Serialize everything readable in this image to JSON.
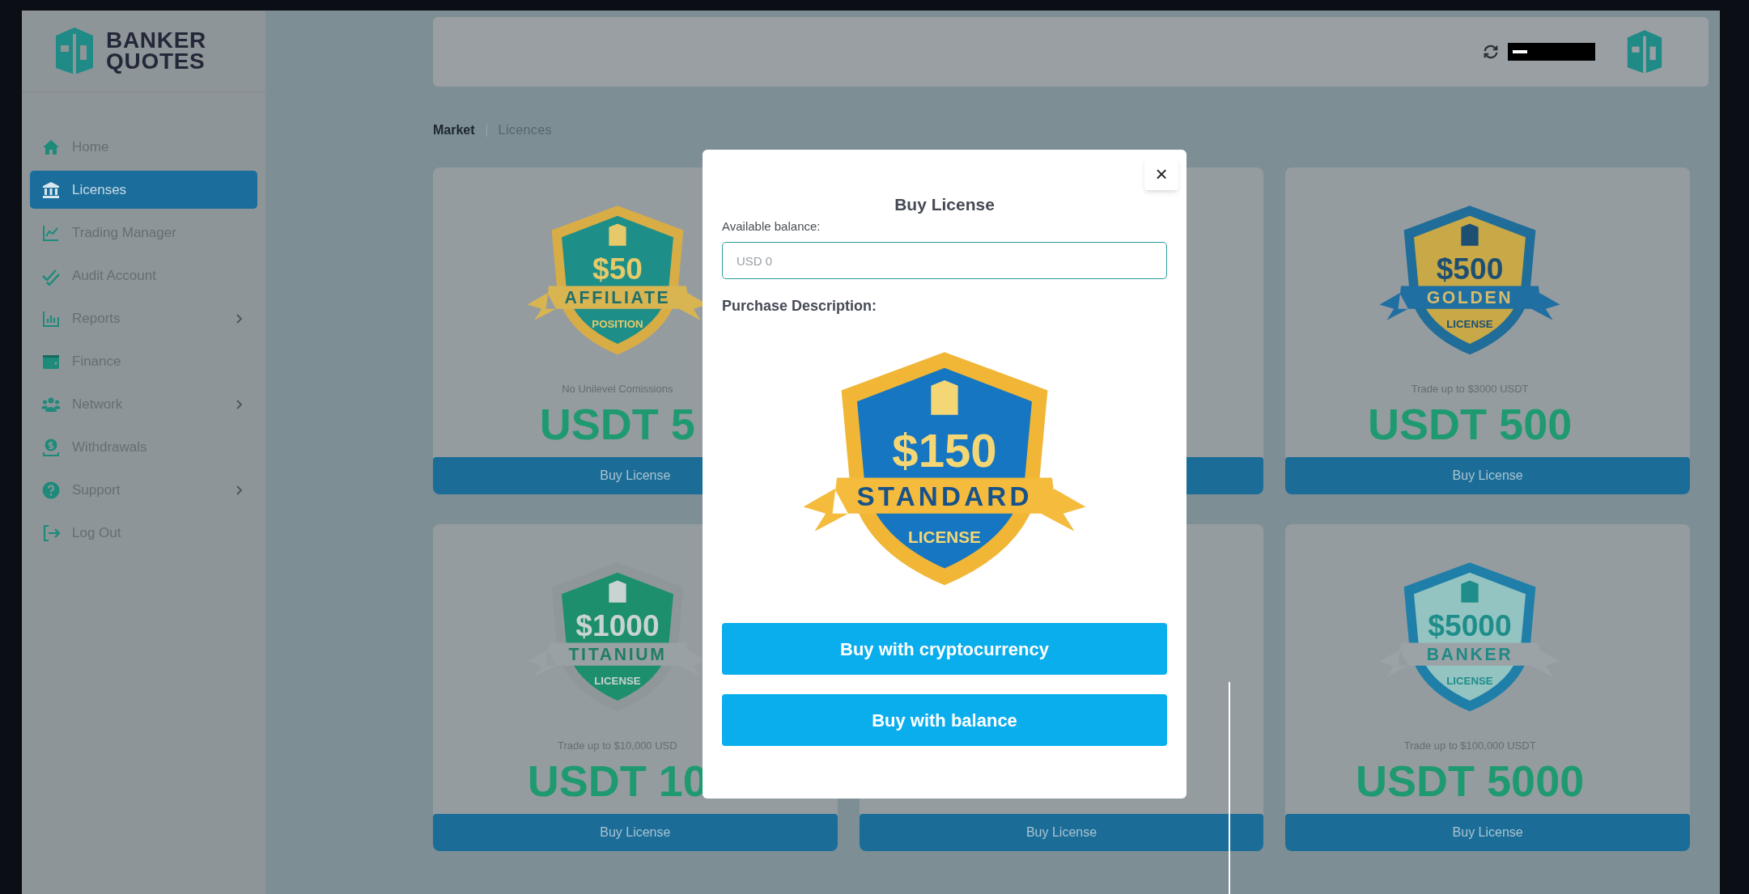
{
  "sidebar": {
    "logo": {
      "line1": "BANKER",
      "line2": "QUOTES"
    },
    "items": [
      {
        "label": "Home",
        "kind": "home",
        "selected": false,
        "expandable": false
      },
      {
        "label": "Licenses",
        "kind": "bank",
        "selected": true,
        "expandable": false
      },
      {
        "label": "Trading Manager",
        "kind": "chart",
        "selected": false,
        "expandable": false
      },
      {
        "label": "Audit Account",
        "kind": "check",
        "selected": false,
        "expandable": false
      },
      {
        "label": "Reports",
        "kind": "bars",
        "selected": false,
        "expandable": true
      },
      {
        "label": "Finance",
        "kind": "wallet",
        "selected": false,
        "expandable": false
      },
      {
        "label": "Network",
        "kind": "people",
        "selected": false,
        "expandable": true
      },
      {
        "label": "Withdrawals",
        "kind": "money",
        "selected": false,
        "expandable": false
      },
      {
        "label": "Support",
        "kind": "help",
        "selected": false,
        "expandable": true
      },
      {
        "label": "Log Out",
        "kind": "logout",
        "selected": false,
        "expandable": false
      }
    ]
  },
  "breadcrumb": [
    {
      "label": "Market",
      "bold": true
    },
    {
      "label": "Licences",
      "bold": false
    }
  ],
  "cards": [
    {
      "kind": "license",
      "badge": {
        "kind": "affiliate",
        "amount": "$50",
        "ribbon": "AFFILIATE",
        "subtitle": "POSITION",
        "color": "#1d8f88"
      },
      "description": "No Unilevel Comissions",
      "price": "USDT 5",
      "button": "Buy License"
    },
    {
      "kind": "covered"
    },
    {
      "kind": "license",
      "badge": {
        "kind": "golden",
        "amount": "$500",
        "ribbon": "GOLDEN",
        "subtitle": "LICENSE",
        "color": "#c8a847"
      },
      "description": "Trade up to $3000 USDT",
      "price": "USDT 500",
      "button": "Buy License"
    },
    {
      "kind": "license",
      "badge": {
        "kind": "titanium",
        "amount": "$1000",
        "ribbon": "TITANIUM",
        "subtitle": "LICENSE",
        "color": "#1d8f6c"
      },
      "description": "Trade up to $10,000 USD",
      "price": "USDT 10",
      "button": "Buy License"
    },
    {
      "kind": "covered",
      "button": "Buy License"
    },
    {
      "kind": "license",
      "badge": {
        "kind": "banker",
        "amount": "$5000",
        "ribbon": "BANKER",
        "subtitle": "LICENSE",
        "color": "#93c4c2"
      },
      "description": "Trade up to $100,000 USDT",
      "price": "USDT 5000",
      "button": "Buy License"
    }
  ],
  "modal": {
    "close": "×",
    "title": "Buy License",
    "balance_label": "Available balance:",
    "balance_field": {
      "placeholder": "USD 0"
    },
    "description_label": "Purchase Description:",
    "badge": {
      "kind": "standard",
      "amount": "$150",
      "ribbon": "STANDARD",
      "subtitle": "LICENSE",
      "color": "#1676c2"
    },
    "buttons": [
      "Buy with cryptocurrency",
      "Buy with balance"
    ]
  }
}
